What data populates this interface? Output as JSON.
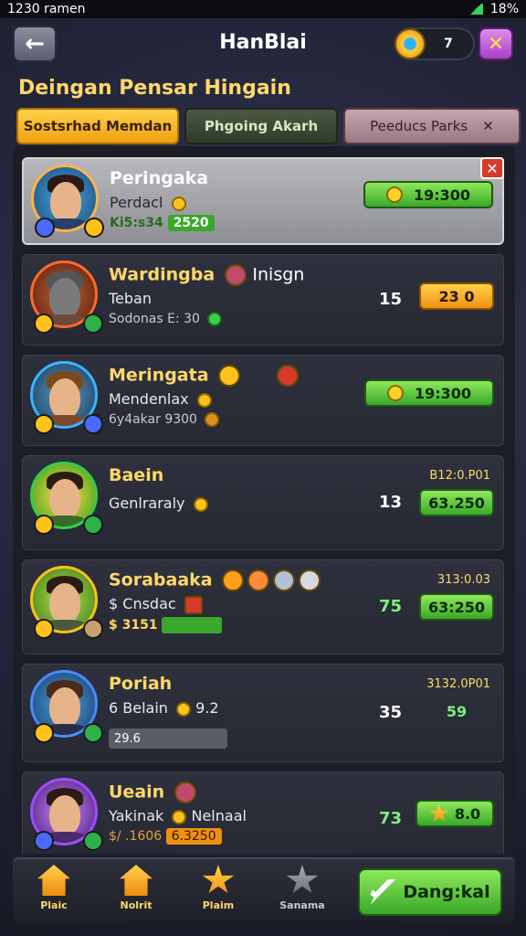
{
  "status_bar": {
    "time": "1230 ramen",
    "battery": "18%"
  },
  "header": {
    "back_icon": "arrow-left-icon",
    "title": "HanBlai",
    "coin_value": "7",
    "close_icon": "close-icon"
  },
  "subheading": "Deingan Pensar Hingain",
  "tabs": [
    {
      "label": "Sostsrhad Memdan",
      "active": true
    },
    {
      "label": "Phgoing Akarh",
      "active": false
    },
    {
      "label": "Peeducs Parks",
      "active": false,
      "close": "✕"
    }
  ],
  "rows": [
    {
      "name": "Peringaka",
      "line2": "Perdacl",
      "line3": "Ki5:s34",
      "line3_value": "2520",
      "score": "19:300",
      "selected": true,
      "ring": "#ffb347",
      "shirt": "#2a3f6a"
    },
    {
      "name": "Wardingba",
      "name_extra": "Inisgn",
      "line2": "Teban",
      "line3": "Sodonas E: 30",
      "rank": "15",
      "score": "23 0",
      "score_style": "orange",
      "ring": "#ff6a2a",
      "shirt": "#6a4a3a"
    },
    {
      "name": "Meringata",
      "line2": "Mendenlax",
      "line3": "6y4akar 9300",
      "score": "19:300",
      "ring": "#38b6ff",
      "shirt": "#7a4a2a"
    },
    {
      "name": "Baein",
      "line2": "Genlraraly",
      "rank": "13",
      "small_top": "B12:0.P01",
      "score": "63.250",
      "ring": "#2fd04a",
      "shirt": "#3a6a2a"
    },
    {
      "name": "Sorabaaka",
      "line2": "$ Cnsdac",
      "line3": "$ 3151",
      "rank": "75",
      "rank_green": true,
      "small_top": "313:0.03",
      "score": "63:250",
      "ring": "#ffc21a",
      "shirt": "#4a5a3a"
    },
    {
      "name": "Poriah",
      "line2": "6 Belain",
      "line2_value": "9.2",
      "line3": "29.6",
      "rank": "35",
      "small_top": "3132.0P01",
      "score": "59",
      "score_style": "dark",
      "ring": "#4a8aff",
      "shirt": "#2a2d4a"
    },
    {
      "name": "Ueain",
      "line2": "Yakinak",
      "line2_value": "Nelnaal",
      "line3": "$/ .1606",
      "line3_value": "6.3250",
      "rank": "73",
      "rank_green": true,
      "score": "8.0",
      "score_style": "star",
      "ring": "#a24aff",
      "shirt": "#4a2a6a"
    }
  ],
  "nav": [
    {
      "label": "Plaic",
      "icon": "house-icon"
    },
    {
      "label": "Nolrit",
      "icon": "house-icon"
    },
    {
      "label": "Plaim",
      "icon": "star-icon"
    },
    {
      "label": "Sanama",
      "icon": "star-grey-icon"
    }
  ],
  "cta": {
    "label": "Dang:kal",
    "icon": "sword-icon"
  }
}
